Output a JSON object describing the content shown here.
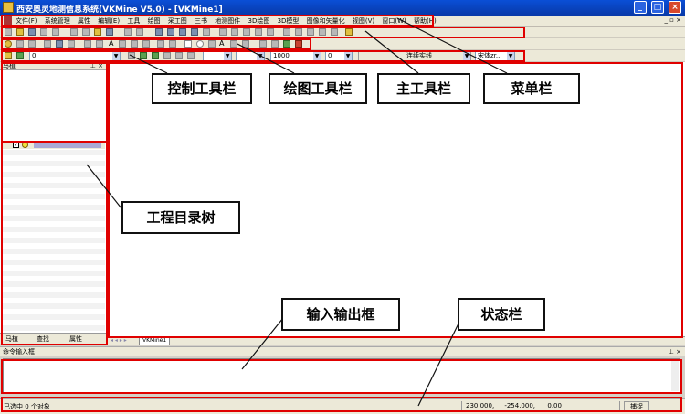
{
  "window": {
    "title": "西安奥灵地测信息系统(VKMine V5.0)   - [VKMine1]",
    "buttons": [
      "_",
      "□",
      "×"
    ]
  },
  "menubar": {
    "items": [
      "文件(F)",
      "系统管理",
      "属性",
      "编辑(E)",
      "工具",
      "绘图",
      "采工图",
      "三书",
      "地测图件",
      "3D绘图",
      "3D模型",
      "图像和矢量化",
      "视图(V)",
      "窗口(W)",
      "帮助(H)"
    ],
    "mdi_buttons": "_ ▫ ×"
  },
  "toolbar_control": {
    "layer_combo": "0",
    "linewidth_combo": "",
    "linetype_combo": "",
    "scale_combo": "1000",
    "size_combo": "0",
    "line_style_combo": "连续实线",
    "font_combo": "宋体zr..."
  },
  "left_panel": {
    "title": "马植",
    "layer_name": "0",
    "tabs": [
      "马植",
      "查找",
      "属性"
    ]
  },
  "doc_tabs": {
    "active_tab": "VKMine1"
  },
  "command": {
    "title": "命令输入框",
    "input_value": ""
  },
  "statusbar": {
    "message": "已选中 0 个对象",
    "x": "230.000,",
    "y": "-254.000,",
    "z": "0.00",
    "snap": "捕捉"
  },
  "callouts": {
    "control_toolbar": "控制工具栏",
    "draw_toolbar": "绘图工具栏",
    "main_toolbar": "主工具栏",
    "menubar": "菜单栏",
    "project_tree": "工程目录树",
    "io_box": "输入输出框",
    "statusbar": "状态栏"
  },
  "colors": {
    "highlight": "#e00000",
    "titlebar": "#0a4fd6",
    "chrome": "#ece9d8"
  }
}
